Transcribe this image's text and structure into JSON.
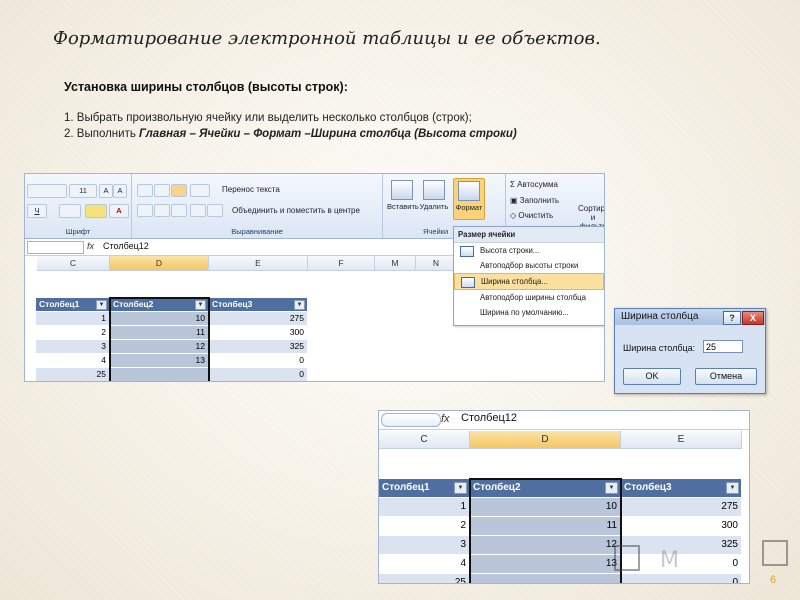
{
  "slide": {
    "title": "Форматирование электронной таблицы и ее объектов.",
    "subtitle": "Установка ширины столбцов (высоты строк):",
    "step1": "1. Выбрать произвольную ячейку или выделить несколько столбцов (строк);",
    "step2_prefix": "2. Выполнить ",
    "step2_path": "Главная – Ячейки – Формат –Ширина столбца (Высота строки)",
    "page_number": "6"
  },
  "ribbon": {
    "font_size": "11",
    "wrap_text": "Перенос текста",
    "merge_center": "Объединить и поместить в центре",
    "group_font": "Шрифт",
    "group_alignment": "Выравнивание",
    "group_cells": "Ячейки",
    "insert": "Вставить",
    "delete": "Удалить",
    "format": "Формат",
    "autosum": "Автосумма",
    "fill": "Заполнить",
    "clear": "Очистить",
    "sort_filter_1": "Сортировка",
    "sort_filter_2": "и фильтр"
  },
  "formula_bar": {
    "fx": "fx",
    "value": "Столбец12"
  },
  "columns_top": [
    "C",
    "D",
    "E",
    "F",
    "M",
    "N"
  ],
  "format_menu": {
    "header": "Размер ячейки",
    "items": [
      "Высота строки...",
      "Автоподбор высоты строки",
      "Ширина столбца...",
      "Автоподбор ширины столбца",
      "Ширина по умолчанию..."
    ],
    "highlighted_index": 2
  },
  "table": {
    "headers": [
      "Столбец1",
      "Столбец2",
      "Столбец3"
    ],
    "rows": [
      [
        "1",
        "10",
        "275"
      ],
      [
        "2",
        "11",
        "300"
      ],
      [
        "3",
        "12",
        "325"
      ],
      [
        "4",
        "13",
        "0"
      ],
      [
        "25",
        "",
        "0"
      ]
    ]
  },
  "dialog": {
    "title": "Ширина столбца",
    "help": "?",
    "close": "X",
    "label": "Ширина столбца:",
    "value": "25",
    "ok": "OK",
    "cancel": "Отмена"
  },
  "columns_zoom": [
    "C",
    "D",
    "E"
  ],
  "watermark_text": "М"
}
